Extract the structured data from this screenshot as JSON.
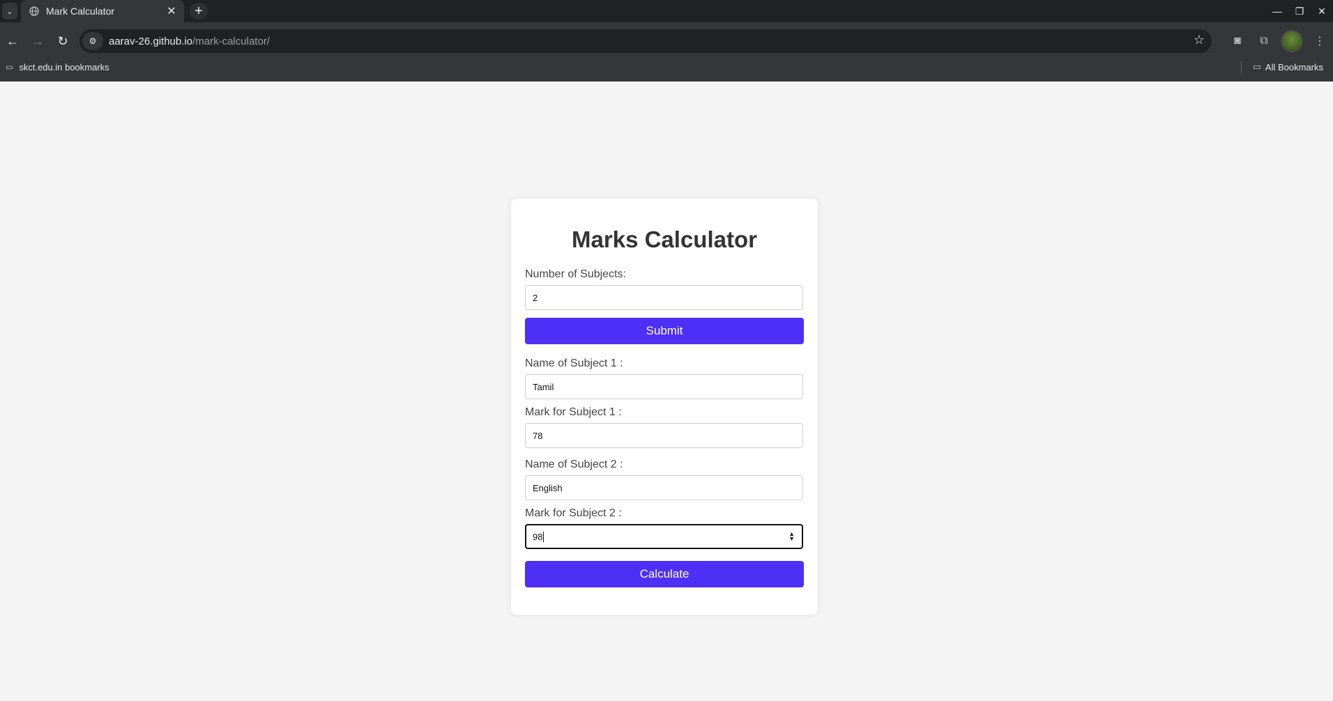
{
  "browser": {
    "tab_title": "Mark Calculator",
    "url_host": "aarav-26.github.io",
    "url_path": "/mark-calculator/",
    "bookmark_left": "skct.edu.in bookmarks",
    "bookmark_right": "All Bookmarks"
  },
  "calculator": {
    "title": "Marks Calculator",
    "num_subjects_label": "Number of Subjects:",
    "num_subjects_value": "2",
    "submit_label": "Submit",
    "subjects": [
      {
        "name_label": "Name of Subject 1 :",
        "name_value": "Tamil",
        "mark_label": "Mark for Subject 1 :",
        "mark_value": "78"
      },
      {
        "name_label": "Name of Subject 2 :",
        "name_value": "English",
        "mark_label": "Mark for Subject 2 :",
        "mark_value": "98"
      }
    ],
    "calculate_label": "Calculate"
  },
  "colors": {
    "accent": "#4d2ff5",
    "page_bg": "#f4f4f4",
    "chrome_dark": "#202124"
  }
}
